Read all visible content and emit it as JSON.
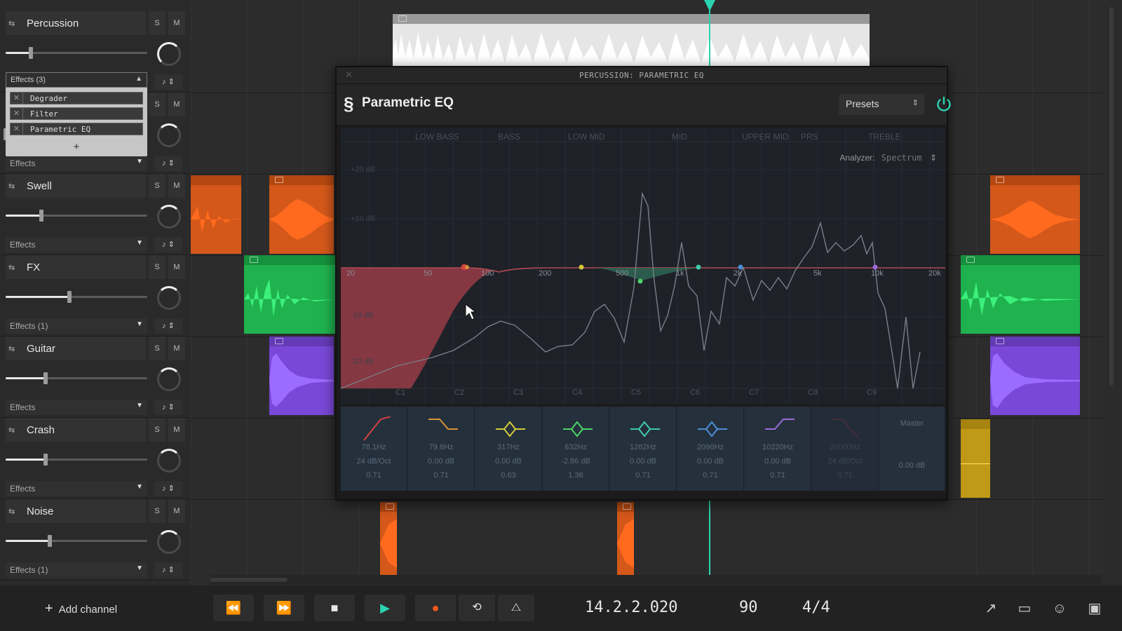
{
  "channels": [
    {
      "name": "Percussion",
      "solo": "S",
      "mute": "M",
      "effects": "Effects (3)",
      "route": "♪ ⇕",
      "level": 0.18,
      "color": "#e8e8e8"
    },
    {
      "name": "",
      "solo": "S",
      "mute": "M",
      "effects": "Effects",
      "route": "♪ ⇕",
      "level": 0,
      "color": "#e8e8e8"
    },
    {
      "name": "Swell",
      "solo": "S",
      "mute": "M",
      "effects": "Effects",
      "route": "♪ ⇕",
      "level": 0.25,
      "color": "#e8e8e8"
    },
    {
      "name": "FX",
      "solo": "S",
      "mute": "M",
      "effects": "Effects (1)",
      "route": "♪ ⇕",
      "level": 0.45,
      "color": "#e8e8e8"
    },
    {
      "name": "Guitar",
      "solo": "S",
      "mute": "M",
      "effects": "Effects",
      "route": "♪ ⇕",
      "level": 0.28,
      "color": "#e8e8e8"
    },
    {
      "name": "Crash",
      "solo": "S",
      "mute": "M",
      "effects": "Effects",
      "route": "♪ ⇕",
      "level": 0.28,
      "color": "#e8e8e8"
    },
    {
      "name": "Noise",
      "solo": "S",
      "mute": "M",
      "effects": "Effects (1)",
      "route": "♪ ⇕",
      "level": 0.31,
      "color": "#e8e8e8"
    }
  ],
  "effects_panel": {
    "header": "Effects (3)",
    "items": [
      "Degrader",
      "Filter",
      "Parametric EQ"
    ],
    "add": "+"
  },
  "plugin": {
    "window_title": "PERCUSSION: PARAMETRIC EQ",
    "name": "Parametric EQ",
    "presets_label": "Presets",
    "analyzer_label": "Analyzer:",
    "analyzer_value": "Spectrum",
    "band_labels": [
      "LOW BASS",
      "BASS",
      "LOW MID",
      "MID",
      "UPPER MID",
      "PRS",
      "TREBLE"
    ],
    "freq_labels": [
      "20",
      "50",
      "100",
      "200",
      "500",
      "1k",
      "2k",
      "5k",
      "10k",
      "20k"
    ],
    "db_labels": [
      "+20 dB",
      "+10 dB",
      "-10 dB",
      "-20 dB"
    ],
    "note_labels": [
      "C1",
      "C2",
      "C3",
      "C4",
      "C5",
      "C6",
      "C7",
      "C8",
      "C9"
    ],
    "bands": [
      {
        "freq": "78.1Hz",
        "gain": "24 dB/Oct",
        "q": "0.71",
        "color": "#d3413f",
        "shape": "highpass"
      },
      {
        "freq": "79.6Hz",
        "gain": "0.00 dB",
        "q": "0.71",
        "color": "#d69137",
        "shape": "lowshelf"
      },
      {
        "freq": "317Hz",
        "gain": "0.00 dB",
        "q": "0.63",
        "color": "#d4c93a",
        "shape": "peak"
      },
      {
        "freq": "632Hz",
        "gain": "-2.86 dB",
        "q": "1.36",
        "color": "#4cd36a",
        "shape": "peak"
      },
      {
        "freq": "1262Hz",
        "gain": "0.00 dB",
        "q": "0.71",
        "color": "#3fc9a6",
        "shape": "peak"
      },
      {
        "freq": "2096Hz",
        "gain": "0.00 dB",
        "q": "0.71",
        "color": "#4a8fd6",
        "shape": "peak"
      },
      {
        "freq": "10220Hz",
        "gain": "0.00 dB",
        "q": "0.71",
        "color": "#9b6bd8",
        "shape": "highshelf"
      },
      {
        "freq": "20000Hz",
        "gain": "24 dB/Oct",
        "q": "0.71",
        "color": "#6a3540",
        "shape": "lowpass"
      }
    ],
    "master_label": "Master",
    "master_gain": "0.00 dB"
  },
  "transport": {
    "add_channel": "Add channel",
    "position": "14.2.2.020",
    "tempo": "90",
    "signature": "4/4"
  },
  "colors": {
    "accent": "#2bd4b0",
    "record": "#ff5a1a",
    "play": "#2bd4b0"
  }
}
